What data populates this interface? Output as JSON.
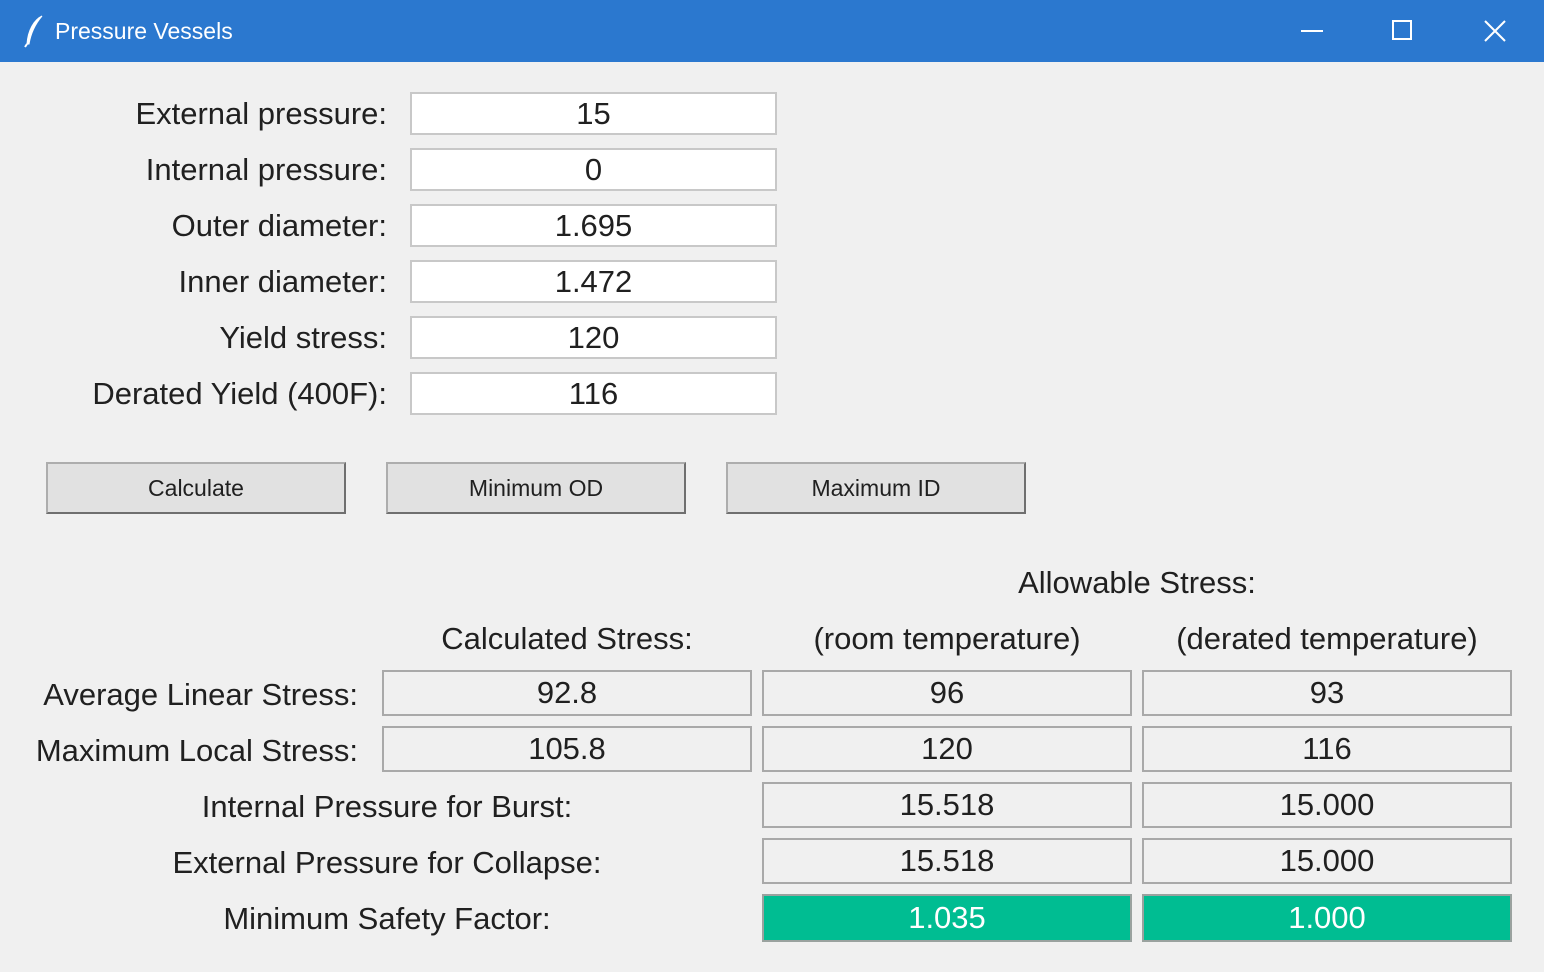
{
  "window": {
    "title": "Pressure Vessels",
    "titlebar_color": "#2b78cf",
    "icon": "feather-icon"
  },
  "inputs": [
    {
      "label": "External pressure:",
      "value": "15"
    },
    {
      "label": "Internal pressure:",
      "value": "0"
    },
    {
      "label": "Outer diameter:",
      "value": "1.695"
    },
    {
      "label": "Inner diameter:",
      "value": "1.472"
    },
    {
      "label": "Yield stress:",
      "value": "120"
    },
    {
      "label": "Derated Yield (400F):",
      "value": "116"
    }
  ],
  "buttons": {
    "calculate": "Calculate",
    "minimum_od": "Minimum OD",
    "maximum_id": "Maximum ID"
  },
  "results": {
    "allowable_header": "Allowable Stress:",
    "calculated_header": "Calculated Stress:",
    "room_header": "(room temperature)",
    "derated_header": "(derated temperature)",
    "avg_linear": {
      "label": "Average Linear Stress:",
      "calculated": "92.8",
      "room": "96",
      "derated": "93"
    },
    "max_local": {
      "label": "Maximum Local Stress:",
      "calculated": "105.8",
      "room": "120",
      "derated": "116"
    },
    "burst": {
      "label": "Internal Pressure for Burst:",
      "room": "15.518",
      "derated": "15.000"
    },
    "collapse": {
      "label": "External Pressure for Collapse:",
      "room": "15.518",
      "derated": "15.000"
    },
    "safety": {
      "label": "Minimum Safety Factor:",
      "room": "1.035",
      "derated": "1.000",
      "status_color": "#00bd92"
    }
  }
}
